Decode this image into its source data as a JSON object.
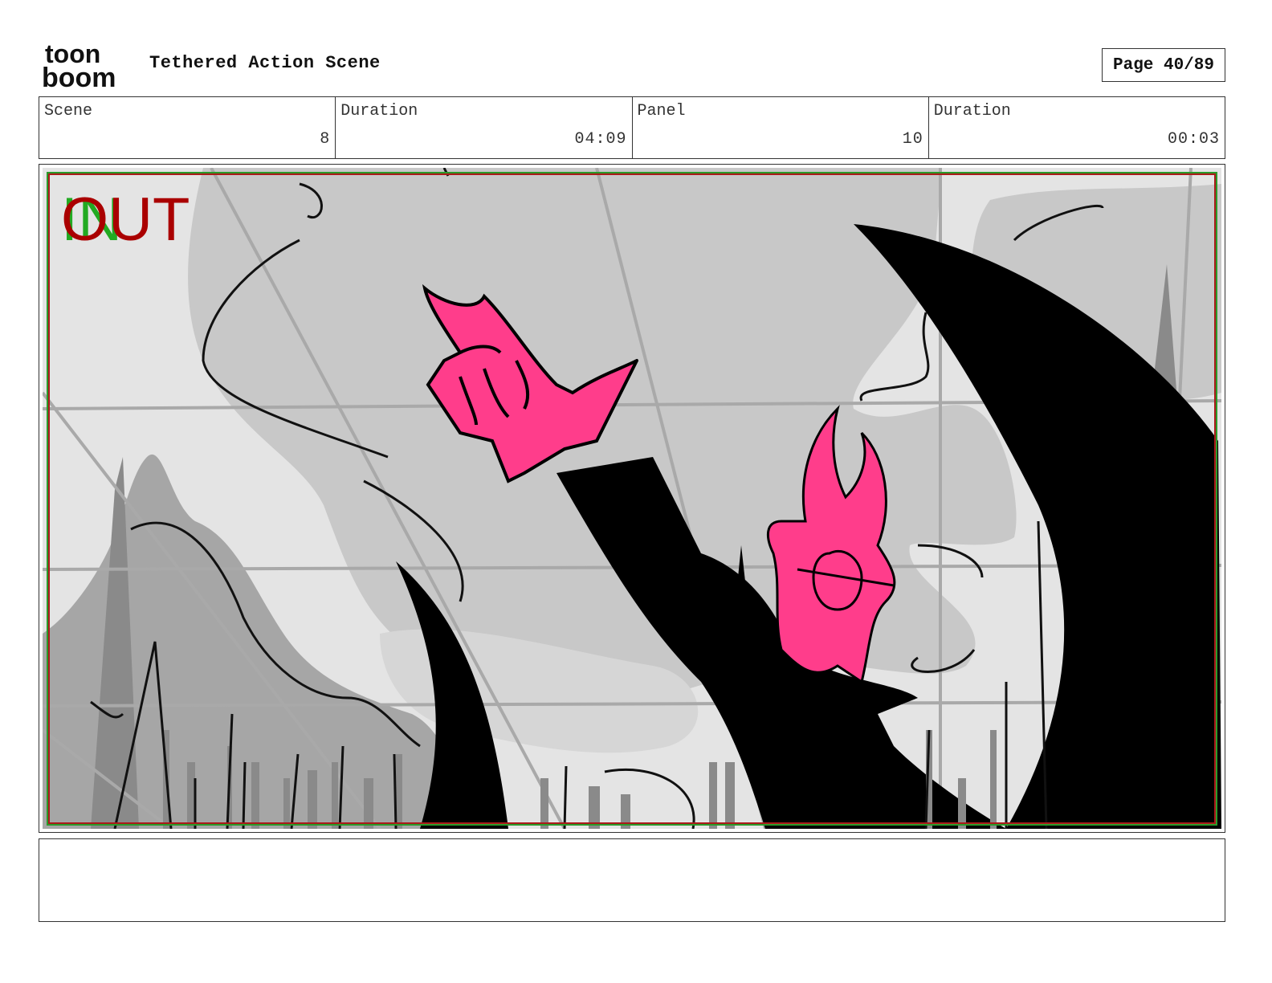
{
  "header": {
    "logo_line1": "toon",
    "logo_line2": "boom",
    "title": "Tethered Action Scene",
    "page": "Page 40/89"
  },
  "info": {
    "scene_label": "Scene",
    "scene_value": "8",
    "scene_duration_label": "Duration",
    "scene_duration_value": "04:09",
    "panel_label": "Panel",
    "panel_value": "10",
    "panel_duration_label": "Duration",
    "panel_duration_value": "00:03"
  },
  "panel": {
    "in_marker": "IN",
    "out_marker": "OUT",
    "colors": {
      "character": "#ff3d8b",
      "silhouette": "#000000",
      "sky_light": "#e4e4e4",
      "sky_mid": "#c8c8c8",
      "mid_gray": "#a6a6a6",
      "frame_red": "#aa1a1a",
      "frame_green": "#2a9a2a"
    }
  },
  "notes": {
    "text": ""
  }
}
